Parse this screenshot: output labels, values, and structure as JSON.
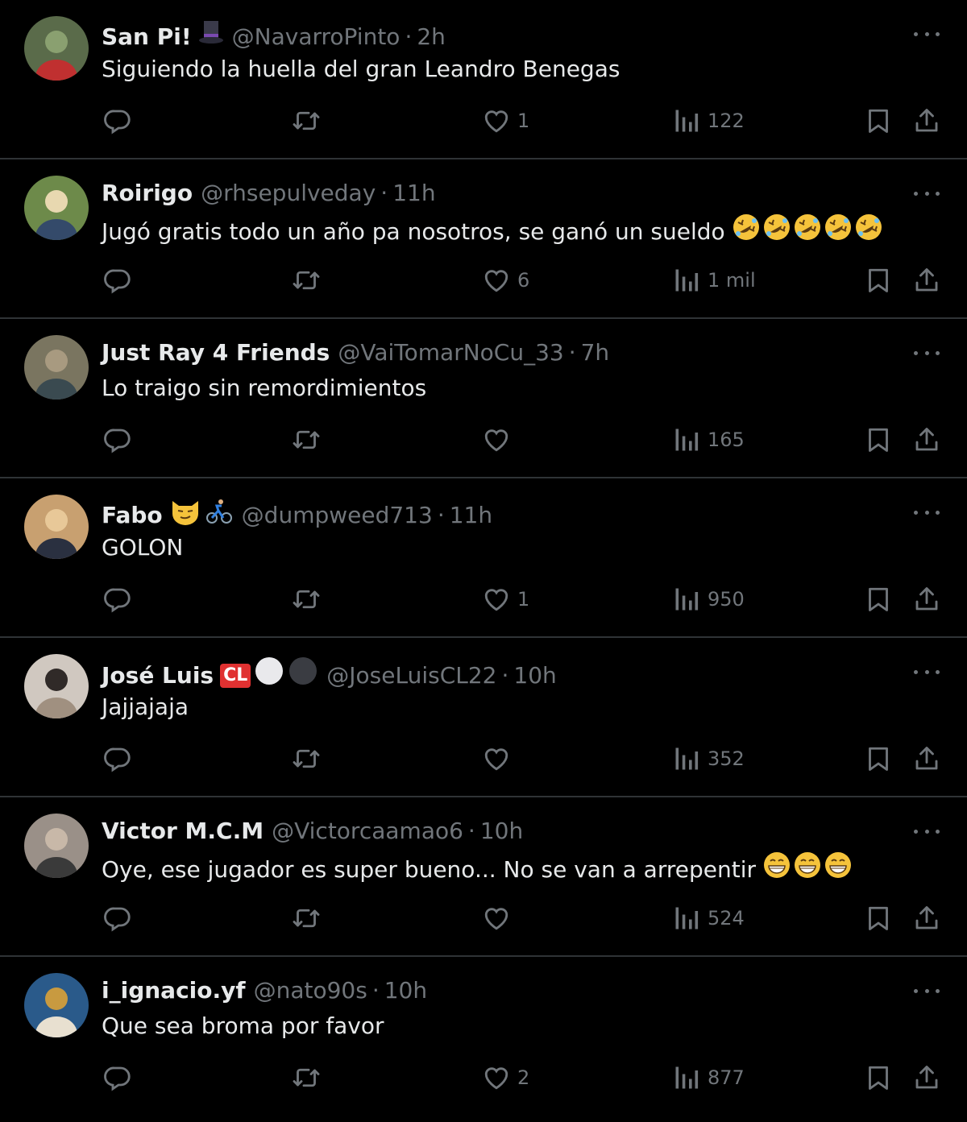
{
  "tweets": [
    {
      "name": "San Pi!",
      "badges": [
        "top-hat-emoji"
      ],
      "handle": "@NavarroPinto",
      "time": "2h",
      "text": "Siguiendo la huella del gran Leandro Benegas",
      "emojis": [],
      "likes": "1",
      "views": "122",
      "avatar_colors": [
        "#5a6b4a",
        "#8aa070",
        "#c03030"
      ]
    },
    {
      "name": "Roirigo",
      "badges": [],
      "handle": "@rhsepulveday",
      "time": "11h",
      "text": "Jugó gratis todo un año pa nosotros, se ganó un sueldo",
      "emojis": [
        "rolling-laughing-emoji",
        "rolling-laughing-emoji",
        "rolling-laughing-emoji",
        "rolling-laughing-emoji",
        "rolling-laughing-emoji"
      ],
      "likes": "6",
      "views": "1 mil",
      "avatar_colors": [
        "#6d8a4a",
        "#e8d8b0",
        "#344a6a"
      ]
    },
    {
      "name": "Just Ray 4 Friends",
      "badges": [],
      "handle": "@VaiTomarNoCu_33",
      "time": "7h",
      "text": "Lo traigo sin remordimientos",
      "emojis": [],
      "likes": "",
      "views": "165",
      "avatar_colors": [
        "#7a7560",
        "#a89a80",
        "#3a4a50"
      ]
    },
    {
      "name": "Fabo",
      "badges": [
        "smirk-cat-emoji",
        "cyclist-emoji"
      ],
      "handle": "@dumpweed713",
      "time": "11h",
      "text": "GOLON",
      "emojis": [],
      "likes": "1",
      "views": "950",
      "avatar_colors": [
        "#c8a070",
        "#e8c898",
        "#2a3040"
      ]
    },
    {
      "name": "José Luis",
      "badges": [
        "cl-badge",
        "white-circle",
        "black-circle"
      ],
      "badge_text": "CL",
      "handle": "@JoseLuisCL22",
      "time": "10h",
      "text": "Jajjajaja",
      "emojis": [],
      "likes": "",
      "views": "352",
      "avatar_colors": [
        "#d0c8c0",
        "#302a28",
        "#a09080"
      ]
    },
    {
      "name": "Victor M.C.M",
      "badges": [],
      "handle": "@Victorcaamao6",
      "time": "10h",
      "text": "Oye, ese jugador es super bueno... No se van a arrepentir",
      "emojis": [
        "grinning-emoji",
        "grinning-emoji",
        "grinning-emoji"
      ],
      "likes": "",
      "views": "524",
      "avatar_colors": [
        "#9a9088",
        "#c8b8a8",
        "#3a3a3a"
      ]
    },
    {
      "name": "i_ignacio.yf",
      "badges": [],
      "handle": "@nato90s",
      "time": "10h",
      "text": "Que sea broma por favor",
      "emojis": [],
      "likes": "2",
      "views": "877",
      "avatar_colors": [
        "#2a5a8a",
        "#c89a40",
        "#e8e0d0"
      ]
    }
  ],
  "colors": {
    "background": "#000000",
    "divider": "#2f3336",
    "text": "#e7e9ea",
    "muted": "#71767b"
  }
}
